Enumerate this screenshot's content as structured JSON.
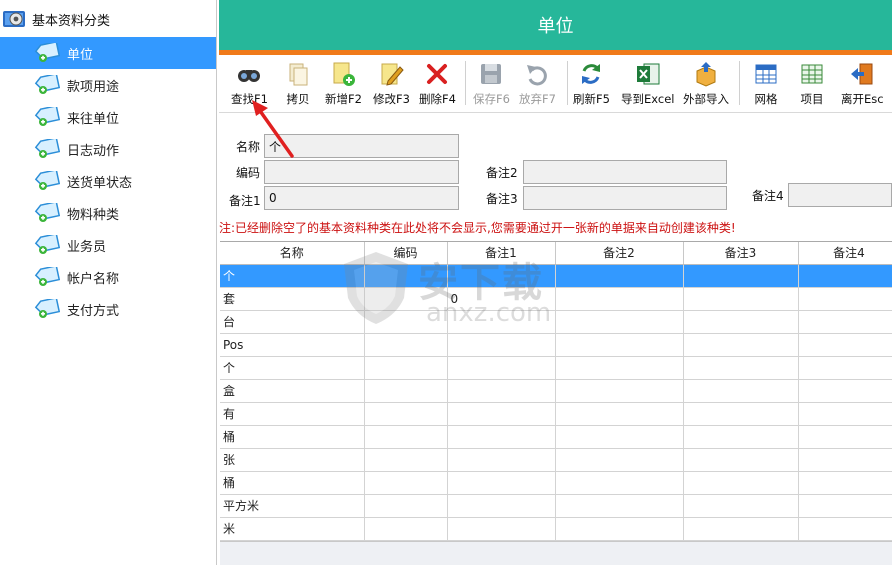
{
  "sidebar": {
    "root_label": "基本资料分类",
    "items": [
      {
        "label": "单位",
        "selected": true
      },
      {
        "label": "款项用途"
      },
      {
        "label": "来往单位"
      },
      {
        "label": "日志动作"
      },
      {
        "label": "送货单状态"
      },
      {
        "label": "物料种类"
      },
      {
        "label": "业务员"
      },
      {
        "label": "帐户名称"
      },
      {
        "label": "支付方式"
      }
    ]
  },
  "header": {
    "title": "单位"
  },
  "toolbar": {
    "search": "查找F1",
    "copy": "拷贝",
    "add": "新增F2",
    "edit": "修改F3",
    "delete": "删除F4",
    "save": "保存F6",
    "discard": "放弃F7",
    "refresh": "刷新F5",
    "export_excel": "导到Excel",
    "import": "外部导入",
    "grid": "网格",
    "items": "项目",
    "exit": "离开Esc"
  },
  "form": {
    "name_label": "名称",
    "name_value": "个",
    "code_label": "编码",
    "code_value": "",
    "note1_label": "备注1",
    "note1_value": "0",
    "note2_label": "备注2",
    "note2_value": "",
    "note3_label": "备注3",
    "note3_value": "",
    "note4_label": "备注4",
    "note4_value": ""
  },
  "notice": "注:已经删除空了的基本资料种类在此处将不会显示,您需要通过开一张新的单据来自动创建该种类!",
  "table": {
    "columns": [
      "名称",
      "编码",
      "备注1",
      "备注2",
      "备注3",
      "备注4"
    ],
    "rows": [
      [
        "个",
        "",
        "",
        "",
        "",
        ""
      ],
      [
        "套",
        "",
        "0",
        "",
        "",
        ""
      ],
      [
        "台",
        "",
        "",
        "",
        "",
        ""
      ],
      [
        "Pos",
        "",
        "",
        "",
        "",
        ""
      ],
      [
        "个",
        "",
        "",
        "",
        "",
        ""
      ],
      [
        "盒",
        "",
        "",
        "",
        "",
        ""
      ],
      [
        "有",
        "",
        "",
        "",
        "",
        ""
      ],
      [
        "桶",
        "",
        "",
        "",
        "",
        ""
      ],
      [
        "张",
        "",
        "",
        "",
        "",
        ""
      ],
      [
        "桶",
        "",
        "",
        "",
        "",
        ""
      ],
      [
        "平方米",
        "",
        "",
        "",
        "",
        ""
      ],
      [
        "米",
        "",
        "",
        "",
        "",
        ""
      ]
    ],
    "selected_row": 0
  },
  "watermark": {
    "cn": "安下载",
    "en": "anxz.com"
  },
  "colors": {
    "header_bg": "#26b79a",
    "header_stripe": "#f07a1a",
    "selection": "#3399ff",
    "notice": "#cc1111"
  }
}
